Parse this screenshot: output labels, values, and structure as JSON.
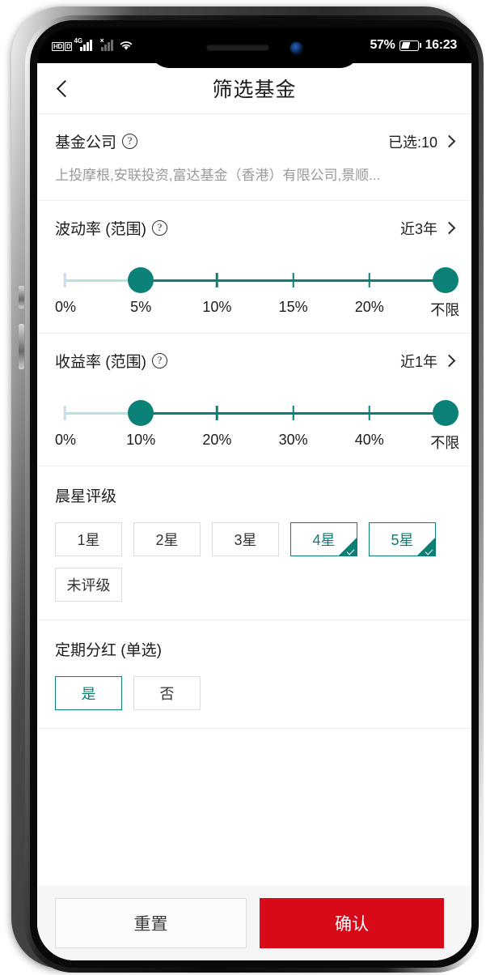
{
  "status_bar": {
    "hd_label": "HD",
    "sim_label": "D",
    "network_label": "4G",
    "no_service_label": "×",
    "signal_icon": "signal-bars-icon",
    "signal_secondary_icon": "signal-bars-dim-icon",
    "wifi_icon": "wifi-icon",
    "battery_percent": "57%",
    "battery_icon": "battery-icon",
    "time": "16:23"
  },
  "nav": {
    "back_icon": "chevron-left-icon",
    "title": "筛选基金"
  },
  "fund_company": {
    "label": "基金公司",
    "help_icon": "question-mark-icon",
    "selected_text": "已选:10",
    "chevron_icon": "chevron-right-icon",
    "value": "上投摩根,安联投资,富达基金（香港）有限公司,景顺..."
  },
  "volatility": {
    "label": "波动率 (范围)",
    "help_icon": "question-mark-icon",
    "period": "近3年",
    "chevron_icon": "chevron-right-icon",
    "ticks": [
      "0%",
      "5%",
      "10%",
      "15%",
      "20%",
      "不限"
    ],
    "low_index": 1,
    "high_index": 5
  },
  "return_rate": {
    "label": "收益率 (范围)",
    "help_icon": "question-mark-icon",
    "period": "近1年",
    "chevron_icon": "chevron-right-icon",
    "ticks": [
      "0%",
      "10%",
      "20%",
      "30%",
      "40%",
      "不限"
    ],
    "low_index": 1,
    "high_index": 5
  },
  "morningstar": {
    "title": "晨星评级",
    "options": [
      {
        "label": "1星",
        "selected": false
      },
      {
        "label": "2星",
        "selected": false
      },
      {
        "label": "3星",
        "selected": false
      },
      {
        "label": "4星",
        "selected": true
      },
      {
        "label": "5星",
        "selected": true
      },
      {
        "label": "未评级",
        "selected": false
      }
    ]
  },
  "dividend": {
    "title": "定期分红 (单选)",
    "options": [
      {
        "label": "是",
        "selected": true
      },
      {
        "label": "否",
        "selected": false
      }
    ]
  },
  "bottom": {
    "reset_label": "重置",
    "confirm_label": "确认"
  },
  "colors": {
    "accent_teal": "#0b7f74",
    "track_inactive": "#b6e3de",
    "confirm_red": "#d80918",
    "chip_border": "#dcdcdc"
  }
}
